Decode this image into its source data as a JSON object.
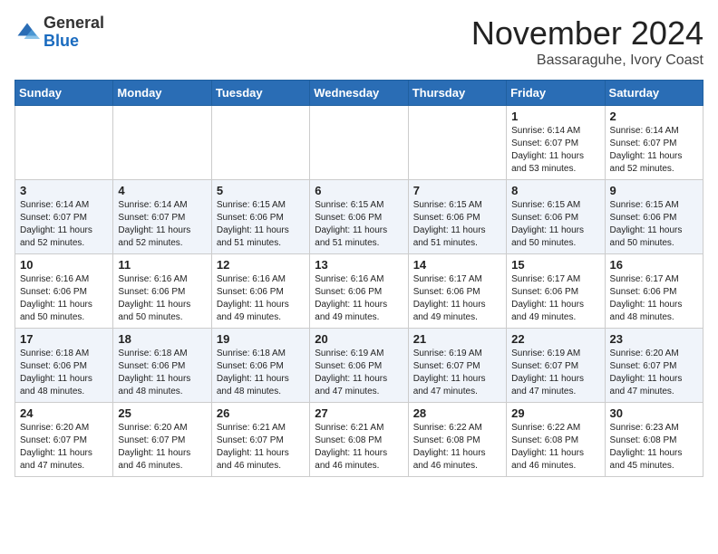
{
  "header": {
    "logo": {
      "general": "General",
      "blue": "Blue"
    },
    "month": "November 2024",
    "location": "Bassaraguhe, Ivory Coast"
  },
  "weekdays": [
    "Sunday",
    "Monday",
    "Tuesday",
    "Wednesday",
    "Thursday",
    "Friday",
    "Saturday"
  ],
  "weeks": [
    [
      {
        "day": "",
        "info": ""
      },
      {
        "day": "",
        "info": ""
      },
      {
        "day": "",
        "info": ""
      },
      {
        "day": "",
        "info": ""
      },
      {
        "day": "",
        "info": ""
      },
      {
        "day": "1",
        "info": "Sunrise: 6:14 AM\nSunset: 6:07 PM\nDaylight: 11 hours and 53 minutes."
      },
      {
        "day": "2",
        "info": "Sunrise: 6:14 AM\nSunset: 6:07 PM\nDaylight: 11 hours and 52 minutes."
      }
    ],
    [
      {
        "day": "3",
        "info": "Sunrise: 6:14 AM\nSunset: 6:07 PM\nDaylight: 11 hours and 52 minutes."
      },
      {
        "day": "4",
        "info": "Sunrise: 6:14 AM\nSunset: 6:07 PM\nDaylight: 11 hours and 52 minutes."
      },
      {
        "day": "5",
        "info": "Sunrise: 6:15 AM\nSunset: 6:06 PM\nDaylight: 11 hours and 51 minutes."
      },
      {
        "day": "6",
        "info": "Sunrise: 6:15 AM\nSunset: 6:06 PM\nDaylight: 11 hours and 51 minutes."
      },
      {
        "day": "7",
        "info": "Sunrise: 6:15 AM\nSunset: 6:06 PM\nDaylight: 11 hours and 51 minutes."
      },
      {
        "day": "8",
        "info": "Sunrise: 6:15 AM\nSunset: 6:06 PM\nDaylight: 11 hours and 50 minutes."
      },
      {
        "day": "9",
        "info": "Sunrise: 6:15 AM\nSunset: 6:06 PM\nDaylight: 11 hours and 50 minutes."
      }
    ],
    [
      {
        "day": "10",
        "info": "Sunrise: 6:16 AM\nSunset: 6:06 PM\nDaylight: 11 hours and 50 minutes."
      },
      {
        "day": "11",
        "info": "Sunrise: 6:16 AM\nSunset: 6:06 PM\nDaylight: 11 hours and 50 minutes."
      },
      {
        "day": "12",
        "info": "Sunrise: 6:16 AM\nSunset: 6:06 PM\nDaylight: 11 hours and 49 minutes."
      },
      {
        "day": "13",
        "info": "Sunrise: 6:16 AM\nSunset: 6:06 PM\nDaylight: 11 hours and 49 minutes."
      },
      {
        "day": "14",
        "info": "Sunrise: 6:17 AM\nSunset: 6:06 PM\nDaylight: 11 hours and 49 minutes."
      },
      {
        "day": "15",
        "info": "Sunrise: 6:17 AM\nSunset: 6:06 PM\nDaylight: 11 hours and 49 minutes."
      },
      {
        "day": "16",
        "info": "Sunrise: 6:17 AM\nSunset: 6:06 PM\nDaylight: 11 hours and 48 minutes."
      }
    ],
    [
      {
        "day": "17",
        "info": "Sunrise: 6:18 AM\nSunset: 6:06 PM\nDaylight: 11 hours and 48 minutes."
      },
      {
        "day": "18",
        "info": "Sunrise: 6:18 AM\nSunset: 6:06 PM\nDaylight: 11 hours and 48 minutes."
      },
      {
        "day": "19",
        "info": "Sunrise: 6:18 AM\nSunset: 6:06 PM\nDaylight: 11 hours and 48 minutes."
      },
      {
        "day": "20",
        "info": "Sunrise: 6:19 AM\nSunset: 6:06 PM\nDaylight: 11 hours and 47 minutes."
      },
      {
        "day": "21",
        "info": "Sunrise: 6:19 AM\nSunset: 6:07 PM\nDaylight: 11 hours and 47 minutes."
      },
      {
        "day": "22",
        "info": "Sunrise: 6:19 AM\nSunset: 6:07 PM\nDaylight: 11 hours and 47 minutes."
      },
      {
        "day": "23",
        "info": "Sunrise: 6:20 AM\nSunset: 6:07 PM\nDaylight: 11 hours and 47 minutes."
      }
    ],
    [
      {
        "day": "24",
        "info": "Sunrise: 6:20 AM\nSunset: 6:07 PM\nDaylight: 11 hours and 47 minutes."
      },
      {
        "day": "25",
        "info": "Sunrise: 6:20 AM\nSunset: 6:07 PM\nDaylight: 11 hours and 46 minutes."
      },
      {
        "day": "26",
        "info": "Sunrise: 6:21 AM\nSunset: 6:07 PM\nDaylight: 11 hours and 46 minutes."
      },
      {
        "day": "27",
        "info": "Sunrise: 6:21 AM\nSunset: 6:08 PM\nDaylight: 11 hours and 46 minutes."
      },
      {
        "day": "28",
        "info": "Sunrise: 6:22 AM\nSunset: 6:08 PM\nDaylight: 11 hours and 46 minutes."
      },
      {
        "day": "29",
        "info": "Sunrise: 6:22 AM\nSunset: 6:08 PM\nDaylight: 11 hours and 46 minutes."
      },
      {
        "day": "30",
        "info": "Sunrise: 6:23 AM\nSunset: 6:08 PM\nDaylight: 11 hours and 45 minutes."
      }
    ]
  ]
}
